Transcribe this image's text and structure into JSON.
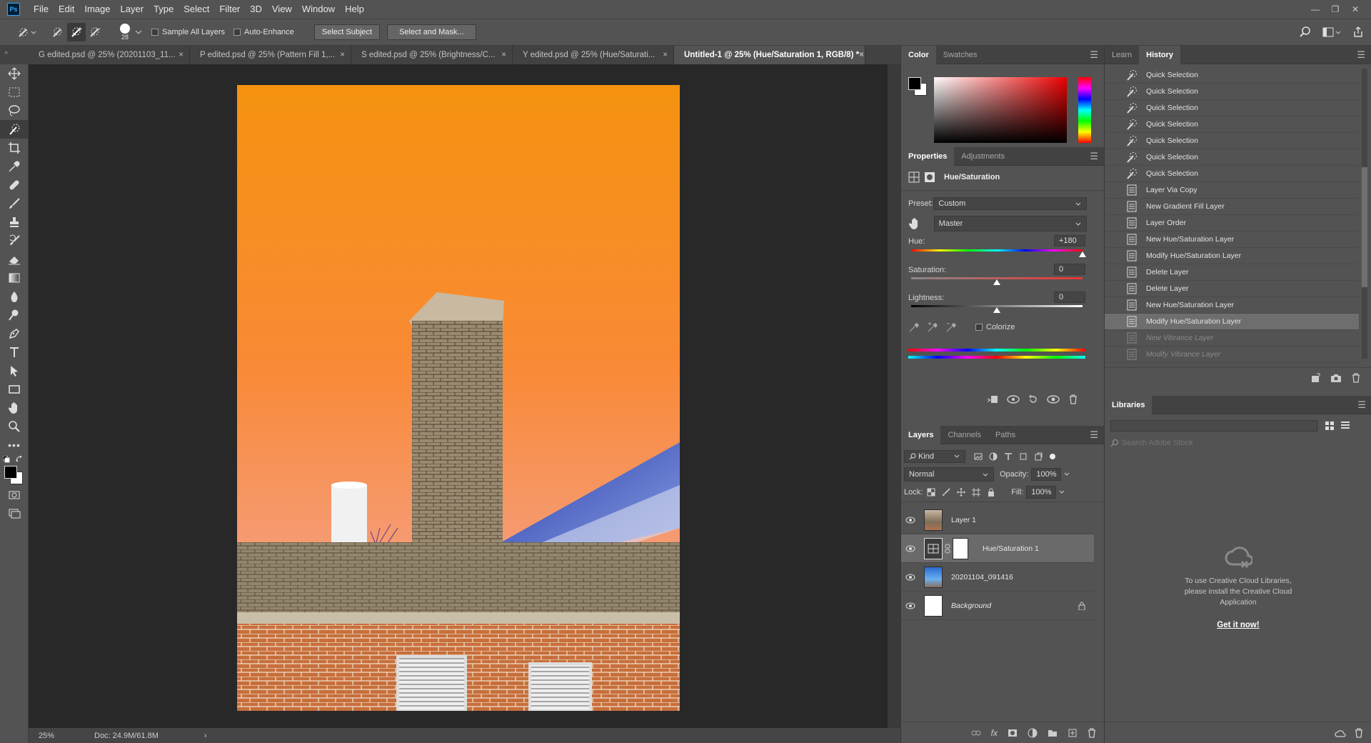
{
  "menu": {
    "logo": "Ps",
    "items": [
      "File",
      "Edit",
      "Image",
      "Layer",
      "Type",
      "Select",
      "Filter",
      "3D",
      "View",
      "Window",
      "Help"
    ]
  },
  "options": {
    "brush_size": "28",
    "sample_all_layers": "Sample All Layers",
    "auto_enhance": "Auto-Enhance",
    "select_subject": "Select Subject",
    "select_and_mask": "Select and Mask..."
  },
  "tabs": [
    {
      "label": "G edited.psd @ 25% (20201103_11...",
      "close": "×"
    },
    {
      "label": "P edited.psd @ 25% (Pattern Fill 1,...",
      "close": "×"
    },
    {
      "label": "S edited.psd @ 25% (Brightness/C...",
      "close": "×"
    },
    {
      "label": "Y edited.psd @ 25% (Hue/Saturati...",
      "close": "×"
    },
    {
      "label": "Untitled-1 @ 25% (Hue/Saturation 1, RGB/8) *",
      "close": "×"
    }
  ],
  "status": {
    "zoom": "25%",
    "doc": "Doc: 24.9M/61.8M",
    "arrow": "›"
  },
  "color_panel": {
    "tabs": [
      "Color",
      "Swatches"
    ]
  },
  "properties": {
    "tabs": [
      "Properties",
      "Adjustments"
    ],
    "title": "Hue/Saturation",
    "preset_label": "Preset:",
    "preset_value": "Custom",
    "channel_value": "Master",
    "hue_label": "Hue:",
    "hue_value": "+180",
    "hue_level": 1.0,
    "saturation_label": "Saturation:",
    "saturation_value": "0",
    "saturation_level": 0.5,
    "lightness_label": "Lightness:",
    "lightness_value": "0",
    "lightness_level": 0.5,
    "colorize": "Colorize"
  },
  "layers_panel": {
    "tabs": [
      "Layers",
      "Channels",
      "Paths"
    ],
    "kind": "Kind",
    "blend_mode": "Normal",
    "opacity_label": "Opacity:",
    "opacity_value": "100%",
    "lock_label": "Lock:",
    "fill_label": "Fill:",
    "fill_value": "100%",
    "layers": [
      {
        "name": "Layer 1"
      },
      {
        "name": "Hue/Saturation 1"
      },
      {
        "name": "20201104_091416"
      },
      {
        "name": "Background"
      }
    ]
  },
  "history": {
    "tabs": [
      "Learn",
      "History"
    ],
    "items": [
      "Quick Selection",
      "Quick Selection",
      "Quick Selection",
      "Quick Selection",
      "Quick Selection",
      "Quick Selection",
      "Quick Selection",
      "Layer Via Copy",
      "New Gradient Fill Layer",
      "Layer Order",
      "New Hue/Saturation Layer",
      "Modify Hue/Saturation Layer",
      "Delete Layer",
      "Delete Layer",
      "New Hue/Saturation Layer",
      "Modify Hue/Saturation Layer",
      "New Vibrance Layer",
      "Modify Vibrance Layer"
    ]
  },
  "libraries": {
    "tab": "Libraries",
    "search_placeholder": "Search Adobe Stock",
    "message": "To use Creative Cloud Libraries, please install the Creative Cloud Application",
    "cta": "Get it now!"
  },
  "colors": {
    "accent": "#31a8ff",
    "selection": "#6e6e6e",
    "canvas_bg": "#282828"
  }
}
